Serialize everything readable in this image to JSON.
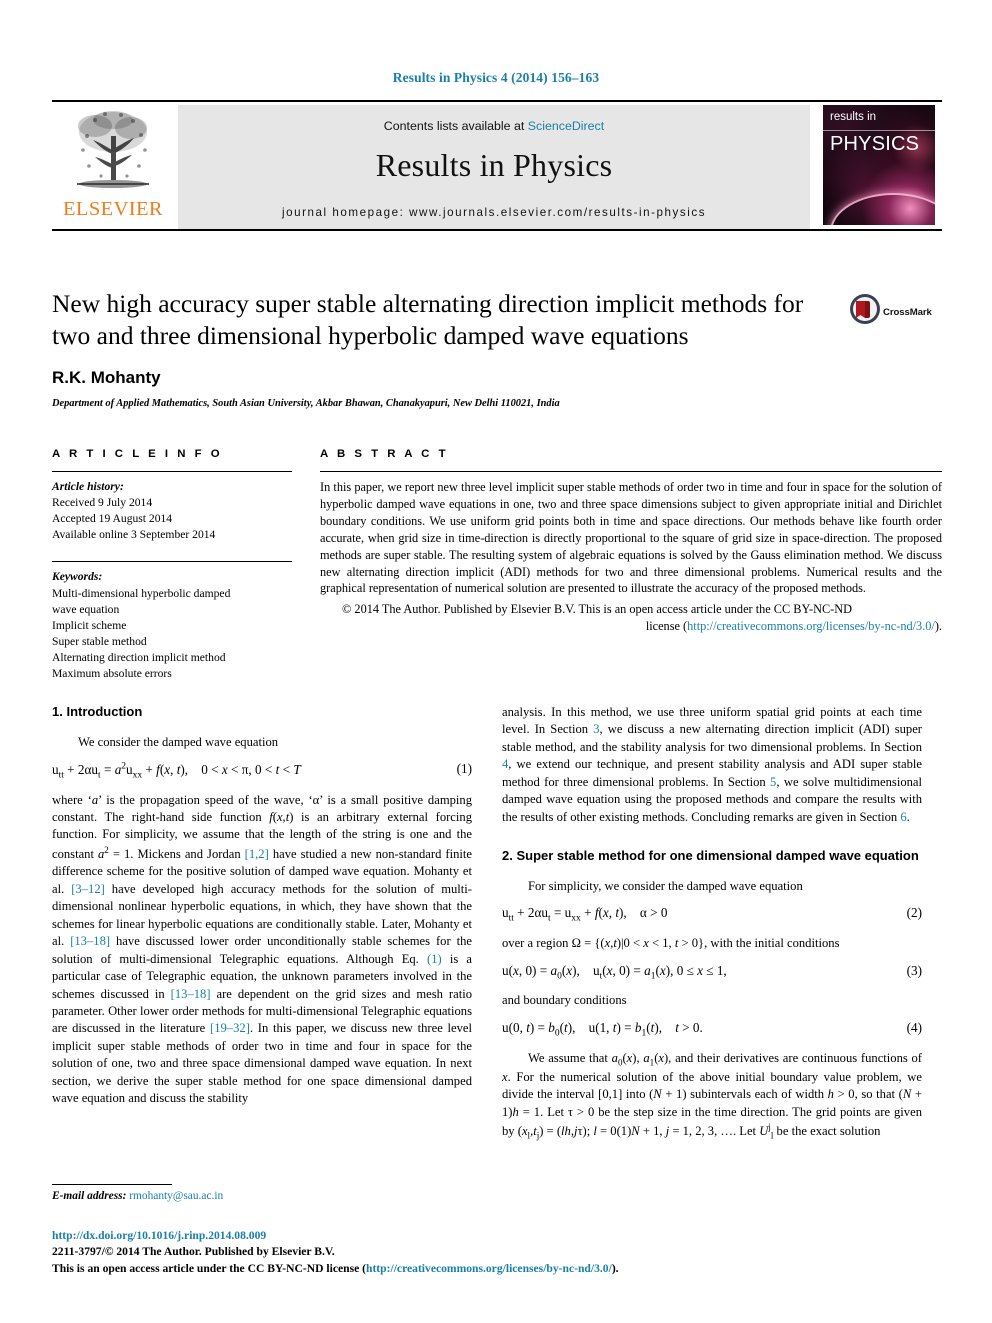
{
  "running_head": "Results in Physics 4 (2014) 156–163",
  "masthead": {
    "publisher": "ELSEVIER",
    "contents_prefix": "Contents lists available at ",
    "contents_link": "ScienceDirect",
    "journal_title": "Results in Physics",
    "homepage_label": "journal homepage: www.journals.elsevier.com/results-in-physics",
    "cover": {
      "line1": "results in",
      "line2": "PHYSICS"
    }
  },
  "title_block": {
    "title": "New high accuracy super stable alternating direction implicit methods for two and three dimensional hyperbolic damped wave equations",
    "authors": "R.K. Mohanty",
    "affiliation": "Department of Applied Mathematics, South Asian University, Akbar Bhawan, Chanakyapuri, New Delhi 110021, India",
    "crossmark_label": "CrossMark"
  },
  "article_info": {
    "heading": "A R T I C L E   I N F O",
    "history_label": "Article history:",
    "history": [
      "Received 9 July 2014",
      "Accepted 19 August 2014",
      "Available online 3 September 2014"
    ],
    "keywords_label": "Keywords:",
    "keywords": [
      "Multi-dimensional hyperbolic damped",
      "wave equation",
      "Implicit scheme",
      "Super stable method",
      "Alternating direction implicit method",
      "Maximum absolute errors"
    ]
  },
  "abstract": {
    "heading": "A B S T R A C T",
    "text": "In this paper, we report new three level implicit super stable methods of order two in time and four in space for the solution of hyperbolic damped wave equations in one, two and three space dimensions subject to given appropriate initial and Dirichlet boundary conditions. We use uniform grid points both in time and space directions. Our methods behave like fourth order accurate, when grid size in time-direction is directly proportional to the square of grid size in space-direction. The proposed methods are super stable. The resulting system of algebraic equations is solved by the Gauss elimination method. We discuss new alternating direction implicit (ADI) methods for two and three dimensional problems. Numerical results and the graphical representation of numerical solution are presented to illustrate the accuracy of the proposed methods.",
    "copyright_lead": "© 2014 The Author. Published by Elsevier B.V. This is an open access article under the CC BY-NC-ND",
    "license_prefix": "license (",
    "license_link": "http://creativecommons.org/licenses/by-nc-nd/3.0/",
    "license_suffix": ")."
  },
  "sections": {
    "intro": {
      "heading": "1. Introduction",
      "p1": "We consider the damped wave equation",
      "eq1": "u<sub>tt</sub> + 2&#945;u<sub>t</sub> = <span class=\"it\">a</span><sup>2</sup>u<sub>xx</sub> + <span class=\"it\">f</span>(<span class=\"it\">x</span>, <span class=\"it\">t</span>),&nbsp;&nbsp;&nbsp; 0 &lt; <span class=\"it\">x</span> &lt; &#960;, 0 &lt; <span class=\"it\">t</span> &lt; <span class=\"it\">T</span>",
      "eq1_num": "(1)",
      "p2_a": "where ‘",
      "p2": "where ‘a’ is the propagation speed of the wave, ‘α’ is a small positive damping constant. The right-hand side function f(x,t) is an arbitrary external forcing function. For simplicity, we assume that the length of the string is one and the constant a",
      "p2_refs": [
        "[1,2]",
        "[3–12]",
        "[13–18]",
        "(1)",
        "[13–18]",
        "[19–32]"
      ],
      "p2_full_html": "where ‘<span class=\"it\">a</span>’ is the propagation speed of the wave, ‘&#945;’ is a small positive damping constant. The right-hand side function <span class=\"it\">f</span>(<span class=\"it\">x</span>,<span class=\"it\">t</span>) is an arbitrary external forcing function. For simplicity, we assume that the length of the string is one and the constant <span class=\"it\">a</span><sup>2</sup> = 1. Mickens and Jordan <a class=\"link\" href=\"#\">[1,2]</a> have studied a new non-standard finite difference scheme for the positive solution of damped wave equation. Mohanty et al. <a class=\"link\" href=\"#\">[3–12]</a> have developed high accuracy methods for the solution of multi-dimensional nonlinear hyperbolic equations, in which, they have shown that the schemes for linear hyperbolic equations are conditionally stable. Later, Mohanty et al. <a class=\"link\" href=\"#\">[13–18]</a> have discussed lower order unconditionally stable schemes for the solution of multi-dimensional Telegraphic equations. Although Eq. <a class=\"link\" href=\"#\">(1)</a> is a particular case of Telegraphic equation, the unknown parameters involved in the schemes discussed in <a class=\"link\" href=\"#\">[13–18]</a> are dependent on the grid sizes and mesh ratio parameter. Other lower order methods for multi-dimensional Telegraphic equations are discussed in the literature <a class=\"link\" href=\"#\">[19–32]</a>. In this paper, we discuss new three level implicit super stable methods of order two in time and four in space for the solution of one, two and three space dimensional damped wave equation. In next section, we derive the super stable method for one space dimensional damped wave equation and discuss the stability"
    },
    "right_lead_html": "analysis. In this method, we use three uniform spatial grid points at each time level. In Section <a class=\"link\" href=\"#\">3</a>, we discuss a new alternating direction implicit (ADI) super stable method, and the stability analysis for two dimensional problems. In Section <a class=\"link\" href=\"#\">4</a>, we extend our technique, and present stability analysis and ADI super stable method for three dimensional problems. In Section <a class=\"link\" href=\"#\">5</a>, we solve multidimensional damped wave equation using the proposed methods and compare the results with the results of other existing methods. Concluding remarks are given in Section <a class=\"link\" href=\"#\">6</a>.",
    "super_stable": {
      "heading": "2. Super stable method for one dimensional damped wave equation",
      "p1": "For simplicity, we consider the damped wave equation",
      "eq2": "u<sub>tt</sub> + 2&#945;u<sub>t</sub> = u<sub>xx</sub> + <span class=\"it\">f</span>(<span class=\"it\">x</span>, <span class=\"it\">t</span>),&nbsp;&nbsp;&nbsp; &#945; &gt; 0",
      "eq2_num": "(2)",
      "p2": "over a region Ω = {(x,t)|0 &lt; x &lt; 1, t &gt; 0}, with the initial conditions",
      "p2_html": "over a region &#937; = {(<span class=\"it\">x</span>,<span class=\"it\">t</span>)|0 &lt; <span class=\"it\">x</span> &lt; 1, <span class=\"it\">t</span> &gt; 0}, with the initial conditions",
      "eq3": "u(<span class=\"it\">x</span>, 0) = <span class=\"it\">a</span><sub>0</sub>(<span class=\"it\">x</span>),&nbsp;&nbsp;&nbsp; u<sub>t</sub>(<span class=\"it\">x</span>, 0) = <span class=\"it\">a</span><sub>1</sub>(<span class=\"it\">x</span>), 0 &#8804; <span class=\"it\">x</span> &#8804; 1,",
      "eq3_num": "(3)",
      "p3": "and boundary conditions",
      "eq4": "u(0, <span class=\"it\">t</span>) = <span class=\"it\">b</span><sub>0</sub>(<span class=\"it\">t</span>),&nbsp;&nbsp;&nbsp; u(1, <span class=\"it\">t</span>) = <span class=\"it\">b</span><sub>1</sub>(<span class=\"it\">t</span>),&nbsp;&nbsp;&nbsp; <span class=\"it\">t</span> &gt; 0.",
      "eq4_num": "(4)",
      "p4_html": "We assume that <span class=\"it\">a</span><sub>0</sub>(<span class=\"it\">x</span>), <span class=\"it\">a</span><sub>1</sub>(<span class=\"it\">x</span>), and their derivatives are continuous functions of <span class=\"it\">x</span>. For the numerical solution of the above initial boundary value problem, we divide the interval [0,1] into (<span class=\"it\">N</span> + 1) subintervals each of width <span class=\"it\">h</span> &gt; 0, so that (<span class=\"it\">N</span> + 1)<span class=\"it\">h</span> = 1. Let &#964; &gt; 0 be the step size in the time direction. The grid points are given by (<span class=\"it\">x</span><sub>l</sub>,<span class=\"it\">t</span><sub>j</sub>) = (<span class=\"it\">lh</span>,<span class=\"it\">j</span>&#964;); <span class=\"it\">l</span> = 0(1)<span class=\"it\">N</span> + 1, <span class=\"it\">j</span> = 1, 2, 3, …. Let <span class=\"it\">U</span><sup>j</sup><sub>l</sub> be the exact solution"
    }
  },
  "footnote": {
    "label": "E-mail address:",
    "email": "rmohanty@sau.ac.in"
  },
  "footer": {
    "doi": "http://dx.doi.org/10.1016/j.rinp.2014.08.009",
    "issn_line": "2211-3797/© 2014 The Author. Published by Elsevier B.V.",
    "license_prefix": "This is an open access article under the CC BY-NC-ND license (",
    "license_link": "http://creativecommons.org/licenses/by-nc-nd/3.0/",
    "license_suffix": ")."
  },
  "colors": {
    "link": "#1a7fa8",
    "elsevier_orange": "#ef7d19",
    "band_gray": "#e6e6e6"
  }
}
